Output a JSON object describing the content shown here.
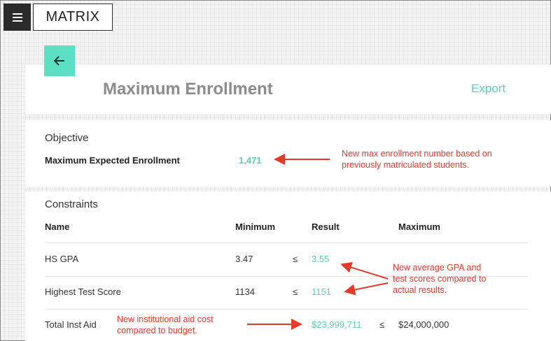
{
  "topbar": {
    "menu_icon": "hamburger-menu-icon",
    "brand": "MATRIX"
  },
  "header": {
    "back_icon": "arrow-left-icon",
    "title": "Maximum Enrollment",
    "export_label": "Export"
  },
  "objective": {
    "section_title": "Objective",
    "label": "Maximum Expected Enrollment",
    "value": "1,471"
  },
  "constraints": {
    "section_title": "Constraints",
    "columns": {
      "name": "Name",
      "minimum": "Minimum",
      "result": "Result",
      "maximum": "Maximum"
    },
    "rows": [
      {
        "name": "HS GPA",
        "minimum": "3.47",
        "op1": "≤",
        "result": "3.55",
        "op2": "",
        "maximum": ""
      },
      {
        "name": "Highest Test Score",
        "minimum": "1134",
        "op1": "≤",
        "result": "1151",
        "op2": "",
        "maximum": ""
      },
      {
        "name": "Total Inst Aid",
        "minimum": "",
        "op1": "",
        "result": "$23,999,711",
        "op2": "≤",
        "maximum": "$24,000,000"
      }
    ]
  },
  "annotations": {
    "enrollment_note": [
      "New max enrollment number based on",
      "previously matriculated students."
    ],
    "gpa_note": [
      "New average GPA and",
      "test scores compared to",
      "actual results."
    ],
    "aid_note": [
      "New institutional aid cost",
      "compared to budget."
    ],
    "color": "#e23b2a"
  },
  "colors": {
    "accent": "#5ce0c3",
    "accent_text": "#5ccfb4",
    "dark": "#2b2b2b"
  }
}
